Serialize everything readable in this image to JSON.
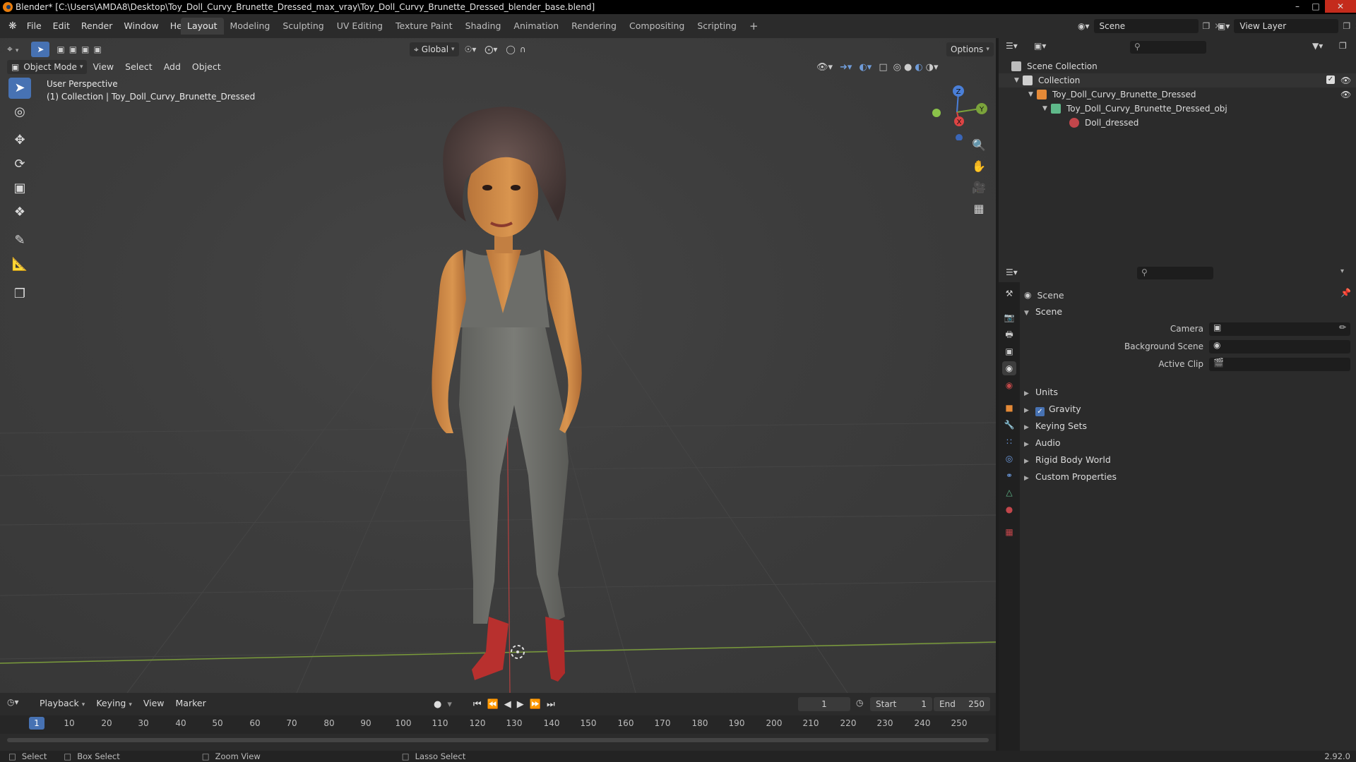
{
  "window": {
    "title": "Blender* [C:\\Users\\AMDA8\\Desktop\\Toy_Doll_Curvy_Brunette_Dressed_max_vray\\Toy_Doll_Curvy_Brunette_Dressed_blender_base.blend]"
  },
  "menu": [
    "File",
    "Edit",
    "Render",
    "Window",
    "Help"
  ],
  "workspaces": [
    "Layout",
    "Modeling",
    "Sculpting",
    "UV Editing",
    "Texture Paint",
    "Shading",
    "Animation",
    "Rendering",
    "Compositing",
    "Scripting"
  ],
  "active_workspace": "Layout",
  "scene_field": "Scene",
  "view_layer_field": "View Layer",
  "viewport": {
    "mode": "Object Mode",
    "header_menus": [
      "View",
      "Select",
      "Add",
      "Object"
    ],
    "orientation": "Global",
    "options_label": "Options",
    "overlay_title": "User Perspective",
    "overlay_subtitle": "(1) Collection | Toy_Doll_Curvy_Brunette_Dressed",
    "gizmo_axes": {
      "z": "Z",
      "y": "Y",
      "x": "X"
    }
  },
  "outliner": {
    "rows": [
      {
        "label": "Scene Collection"
      },
      {
        "label": "Collection"
      },
      {
        "label": "Toy_Doll_Curvy_Brunette_Dressed"
      },
      {
        "label": "Toy_Doll_Curvy_Brunette_Dressed_obj"
      },
      {
        "label": "Doll_dressed"
      }
    ]
  },
  "properties": {
    "context": "Scene",
    "panel": "Scene",
    "fields": [
      {
        "label": "Camera"
      },
      {
        "label": "Background Scene"
      },
      {
        "label": "Active Clip"
      }
    ],
    "sections": [
      "Units",
      "Gravity",
      "Keying Sets",
      "Audio",
      "Rigid Body World",
      "Custom Properties"
    ],
    "gravity_checked": true
  },
  "timeline": {
    "menus": [
      "Playback",
      "Keying",
      "View",
      "Marker"
    ],
    "current_frame": "1",
    "start_label": "Start",
    "start_value": "1",
    "end_label": "End",
    "end_value": "250",
    "ticks": [
      "10",
      "20",
      "30",
      "40",
      "50",
      "60",
      "70",
      "80",
      "90",
      "100",
      "110",
      "120",
      "130",
      "140",
      "150",
      "160",
      "170",
      "180",
      "190",
      "200",
      "210",
      "220",
      "230",
      "240",
      "250"
    ],
    "playhead_label": "1"
  },
  "statusbar": {
    "items": [
      "Select",
      "Box Select",
      "Zoom View",
      "Lasso Select"
    ],
    "version": "2.92.0"
  }
}
